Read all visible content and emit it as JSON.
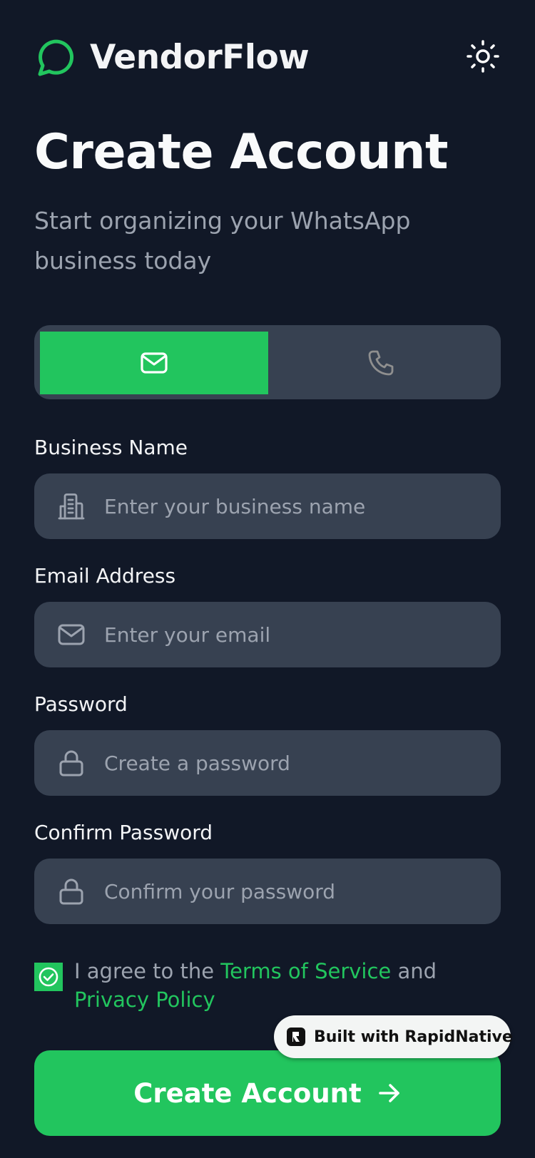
{
  "header": {
    "app_name": "VendorFlow",
    "logo_icon": "chat-bubble-icon",
    "theme_toggle_icon": "sun-icon"
  },
  "title": "Create Account",
  "subtitle": "Start organizing your WhatsApp business today",
  "signup_method": {
    "options": [
      {
        "icon": "mail-icon",
        "selected": true
      },
      {
        "icon": "phone-icon",
        "selected": false
      }
    ]
  },
  "form": {
    "business_name": {
      "label": "Business Name",
      "placeholder": "Enter your business name",
      "value": "",
      "icon": "building-icon"
    },
    "email": {
      "label": "Email Address",
      "placeholder": "Enter your email",
      "value": "",
      "icon": "mail-icon"
    },
    "password": {
      "label": "Password",
      "placeholder": "Create a password",
      "value": "",
      "icon": "lock-icon"
    },
    "confirm_password": {
      "label": "Confirm Password",
      "placeholder": "Confirm your password",
      "value": "",
      "icon": "lock-icon"
    }
  },
  "agreement": {
    "checked": true,
    "prefix": "I agree to the ",
    "terms_link": "Terms of Service",
    "conjunction": " and ",
    "privacy_link": "Privacy Policy"
  },
  "submit": {
    "label": "Create Account",
    "icon": "arrow-right-icon"
  },
  "badge": {
    "text": "Built with RapidNative"
  },
  "colors": {
    "background": "#111827",
    "surface": "#374151",
    "accent": "#22c55e",
    "text_primary": "#f3f4f6",
    "text_muted": "#9ca3af"
  }
}
